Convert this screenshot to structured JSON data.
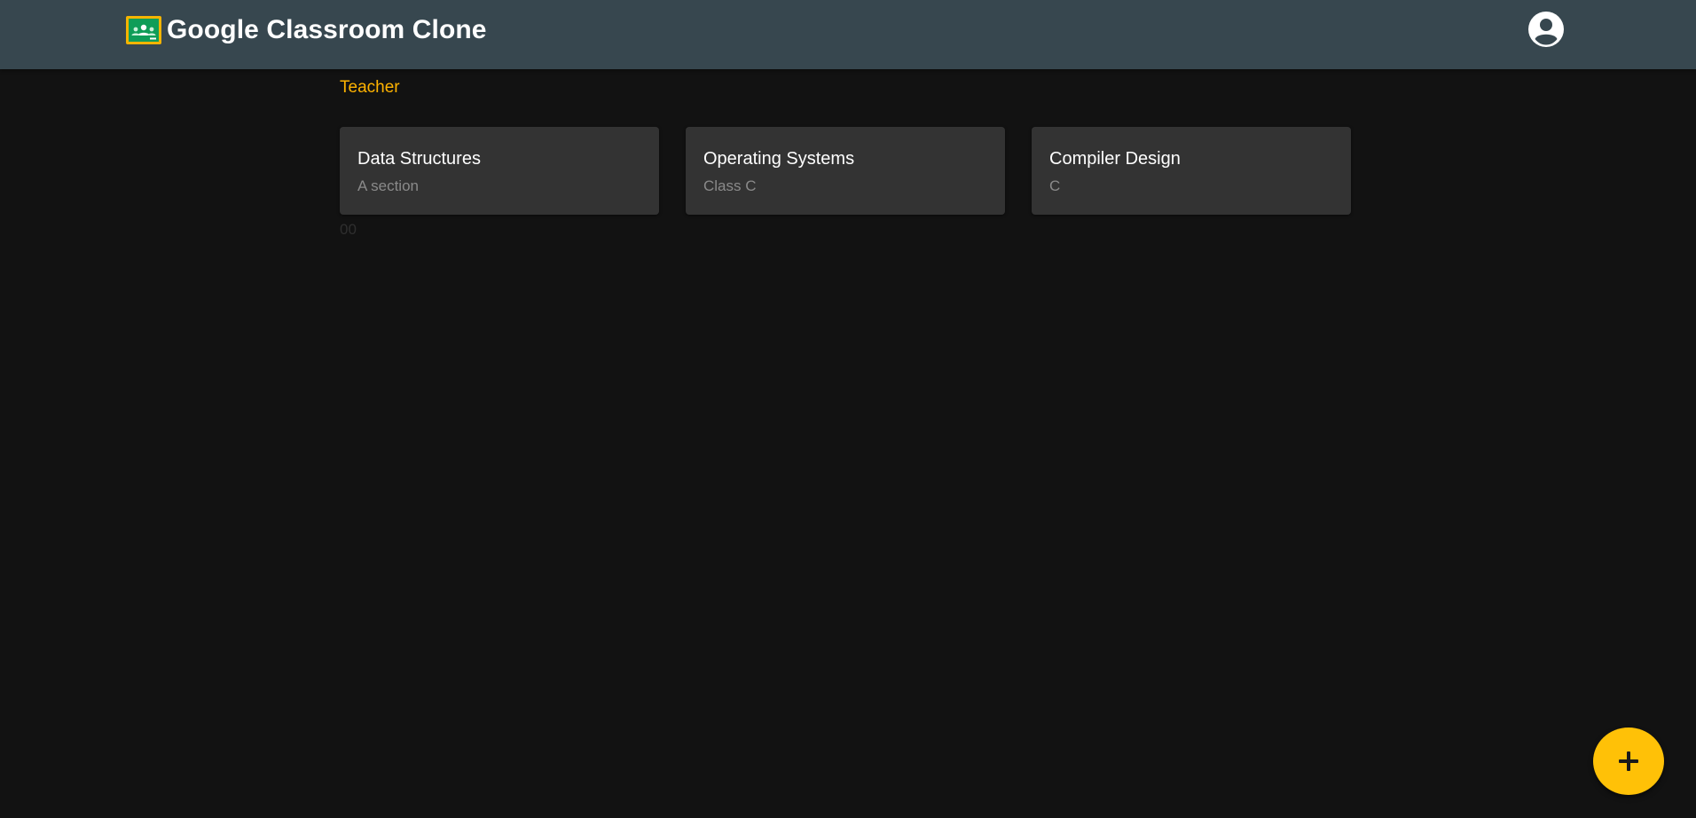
{
  "header": {
    "title": "Google Classroom Clone",
    "logo_icon": "google-classroom-icon",
    "account_icon": "account-circle-icon",
    "background_color": "#37474f"
  },
  "main": {
    "role_label": "Teacher",
    "role_color": "#ffb300",
    "classes": [
      {
        "name": "Data Structures",
        "section": "A section"
      },
      {
        "name": "Operating Systems",
        "section": "Class C"
      },
      {
        "name": "Compiler Design",
        "section": "C"
      }
    ],
    "faint_text": "00"
  },
  "fab": {
    "icon": "plus-icon",
    "color": "#ffc107"
  }
}
